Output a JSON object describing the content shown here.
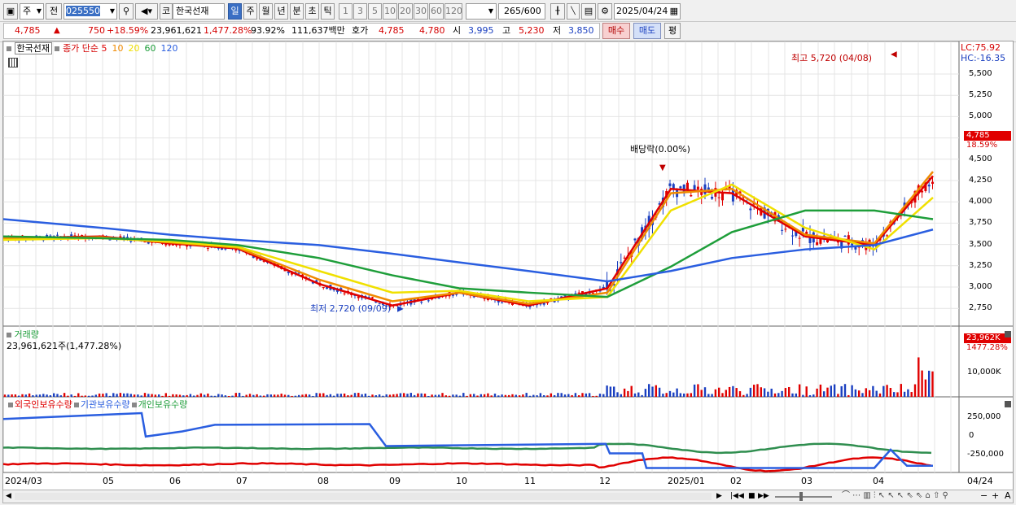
{
  "toolbar": {
    "chart_type_icon": "candle-chart-icon",
    "period_type": "주",
    "prev_label": "전",
    "code_value": "025550",
    "search_icon": "search-icon",
    "speaker_icon": "speaker-icon",
    "name_prefix": "코",
    "stock_name": "한국선재",
    "periods": [
      "일",
      "주",
      "월",
      "년",
      "분",
      "초",
      "틱"
    ],
    "intervals": [
      "1",
      "3",
      "5",
      "10",
      "20",
      "30",
      "60",
      "120"
    ],
    "count_value": "265",
    "count_total": "/600",
    "date_value": "2025/04/24"
  },
  "quote": {
    "price": "4,785",
    "price_arrow": "▲",
    "change": "750",
    "change_pct": "+18.59%",
    "volume": "23,961,621",
    "volume_pct": "1,477.28%",
    "ratio": "93.92%",
    "amount": "111,637백만",
    "bid_label": "호가",
    "ask_price": "4,785",
    "bid_price": "4,780",
    "open_label": "시",
    "open": "3,995",
    "high_label": "고",
    "high": "5,230",
    "low_label": "저",
    "low": "3,850",
    "buy_label": "매수",
    "sell_label": "매도",
    "eval_label": "평"
  },
  "legend": {
    "stock": "한국선재",
    "ma_label": "종가 단순",
    "ma_periods": [
      {
        "label": "5",
        "color": "#e00000"
      },
      {
        "label": "10",
        "color": "#f08a00"
      },
      {
        "label": "20",
        "color": "#f0e000"
      },
      {
        "label": "60",
        "color": "#1e9e3a"
      },
      {
        "label": "120",
        "color": "#2a5ee0"
      }
    ],
    "lc": "LC:75.92",
    "hc": "HC:-16.35"
  },
  "annotations": {
    "high_note": "최고 5,720 (04/08)",
    "low_note": "최저 2,720 (09/09)",
    "dividend": "배당락(0.00%)"
  },
  "price_axis": {
    "labels": [
      "5,500",
      "5,250",
      "5,000",
      "4,750",
      "4,500",
      "4,250",
      "4,000",
      "3,750",
      "3,500",
      "3,250",
      "3,000",
      "2,750"
    ],
    "current": "4,785",
    "current_pct": "18.59%"
  },
  "volume_panel": {
    "title": "거래량",
    "value": "23,961,621주(1,477.28%)",
    "axis_label": "10,000K",
    "current": "23,962K",
    "current_pct": "1477.28%"
  },
  "holding_panel": {
    "series": [
      {
        "name": "외국인보유수량",
        "color": "#e00000"
      },
      {
        "name": "기관보유수량",
        "color": "#2a5ee0"
      },
      {
        "name": "개인보유수량",
        "color": "#1e9e3a"
      }
    ],
    "axis_labels": [
      "250,000",
      "0",
      "-250,000"
    ]
  },
  "x_axis": {
    "labels": [
      "2024/03",
      "05",
      "06",
      "07",
      "08",
      "09",
      "10",
      "11",
      "12",
      "2025/01",
      "02",
      "03",
      "04"
    ],
    "end_label": "04/24"
  },
  "colors": {
    "up": "#e00000",
    "down": "#1a3fc0",
    "ma5": "#e00000",
    "ma10": "#f08a00",
    "ma20": "#f0e000",
    "ma60": "#1e9e3a",
    "ma120": "#2a5ee0"
  },
  "chart_data": {
    "type": "line",
    "title": "한국선재",
    "y_range": [
      2600,
      5800
    ],
    "series": [
      {
        "name": "5",
        "x": [
          "2024/03",
          "05",
          "06",
          "07",
          "08",
          "09",
          "10",
          "11",
          "12",
          "2025/01",
          "02",
          "03",
          "04",
          "04/24"
        ],
        "values": [
          3580,
          3600,
          3520,
          3460,
          3050,
          2800,
          2950,
          2800,
          3000,
          4150,
          4100,
          3600,
          3500,
          4300
        ]
      },
      {
        "name": "10",
        "x": [
          "2024/03",
          "05",
          "06",
          "07",
          "08",
          "09",
          "10",
          "11",
          "12",
          "2025/01",
          "02",
          "03",
          "04",
          "04/24"
        ],
        "values": [
          3580,
          3590,
          3530,
          3470,
          3100,
          2850,
          2950,
          2820,
          2950,
          4100,
          4150,
          3620,
          3520,
          4350
        ]
      },
      {
        "name": "20",
        "x": [
          "2024/03",
          "05",
          "06",
          "07",
          "08",
          "09",
          "10",
          "11",
          "12",
          "2025/01",
          "02",
          "03",
          "04",
          "04/24"
        ],
        "values": [
          3560,
          3580,
          3540,
          3480,
          3200,
          2950,
          2970,
          2850,
          2900,
          3900,
          4200,
          3700,
          3450,
          4050
        ]
      },
      {
        "name": "60",
        "x": [
          "2024/03",
          "05",
          "06",
          "07",
          "08",
          "09",
          "10",
          "11",
          "12",
          "2025/01",
          "02",
          "03",
          "04",
          "04/24"
        ],
        "values": [
          3600,
          3580,
          3560,
          3500,
          3350,
          3150,
          3000,
          2950,
          2900,
          3250,
          3650,
          3900,
          3900,
          3800
        ]
      },
      {
        "name": "120",
        "x": [
          "2024/03",
          "05",
          "06",
          "07",
          "08",
          "09",
          "10",
          "11",
          "12",
          "2025/01",
          "02",
          "03",
          "04",
          "04/24"
        ],
        "values": [
          3800,
          3700,
          3620,
          3560,
          3500,
          3400,
          3300,
          3200,
          3080,
          3200,
          3350,
          3450,
          3500,
          3680
        ]
      }
    ],
    "high": {
      "value": 5720,
      "date": "04/08"
    },
    "low": {
      "value": 2720,
      "date": "09/09"
    }
  }
}
